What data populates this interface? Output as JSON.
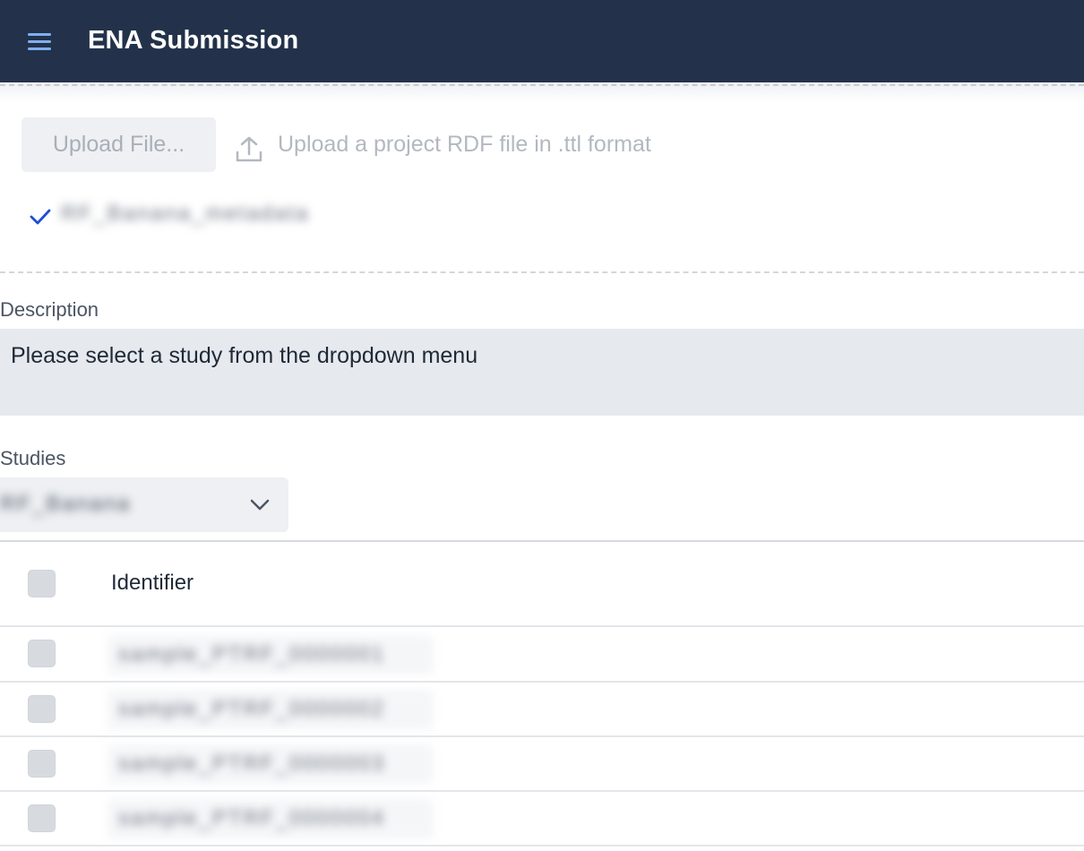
{
  "header": {
    "menu_icon": "hamburger-menu-icon",
    "title": "ENA Submission"
  },
  "upload": {
    "button_label": "Upload File...",
    "hint": "Upload a project RDF file in .ttl format",
    "upload_icon": "upload-icon",
    "uploaded_file": "RF_Banana_metadata",
    "uploaded_status_icon": "checkmark-icon"
  },
  "description": {
    "label": "Description",
    "value": "Please select a study from the dropdown menu"
  },
  "studies": {
    "label": "Studies",
    "selected": "RF_Banana",
    "dropdown_icon": "chevron-down-icon"
  },
  "table": {
    "columns": [
      "Identifier"
    ],
    "rows": [
      {
        "identifier": "sample_PTRF_0000001"
      },
      {
        "identifier": "sample_PTRF_0000002"
      },
      {
        "identifier": "sample_PTRF_0000003"
      },
      {
        "identifier": "sample_PTRF_0000004"
      }
    ]
  },
  "colors": {
    "topbar": "#23324a",
    "accent": "#1d4ed8",
    "menu_icon": "#7fb0f0"
  }
}
